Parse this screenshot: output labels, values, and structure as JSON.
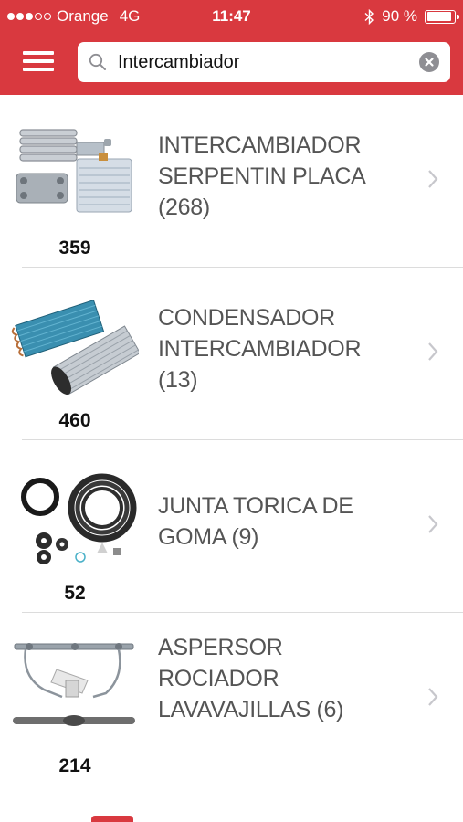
{
  "status_bar": {
    "carrier": "Orange",
    "network": "4G",
    "time": "11:47",
    "battery": "90 %",
    "battery_level": 0.9
  },
  "search": {
    "value": "Intercambiador"
  },
  "results": [
    {
      "title": "INTERCAMBIADOR SERPENTIN PLACA (268)",
      "code": "359"
    },
    {
      "title": "CONDENSADOR INTERCAMBIADOR (13)",
      "code": "460"
    },
    {
      "title": "JUNTA TORICA DE GOMA (9)",
      "code": "52"
    },
    {
      "title": "ASPERSOR ROCIADOR LAVAVAJILLAS (6)",
      "code": "214"
    }
  ],
  "colors": {
    "brand": "#d9393f",
    "label_text": "#555555",
    "chevron": "#c7c7cc"
  }
}
